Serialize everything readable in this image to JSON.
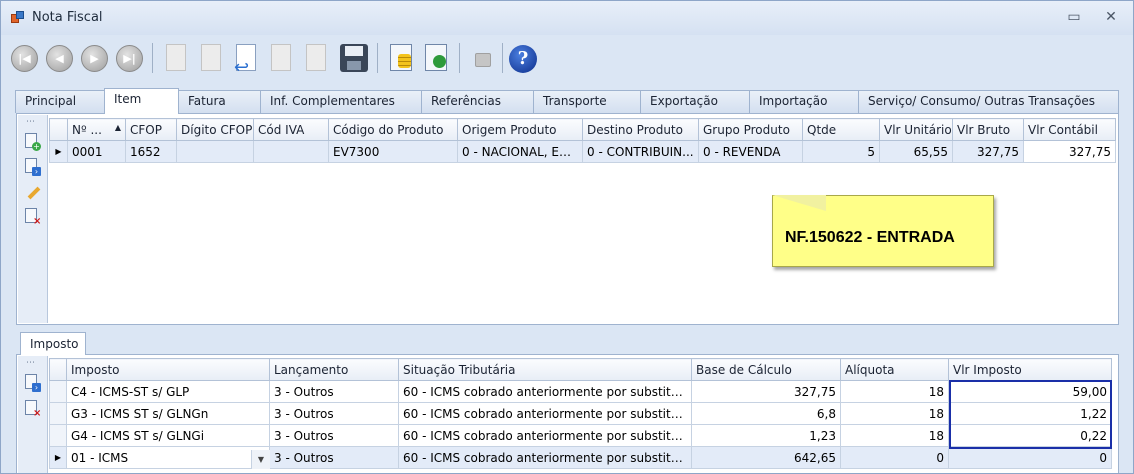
{
  "window": {
    "title": "Nota Fiscal",
    "minimize": "▭",
    "close": "✕"
  },
  "toolbar": {
    "help": "?"
  },
  "tabs": [
    "Principal",
    "Item",
    "Fatura",
    "Inf. Complementares",
    "Referências",
    "Transporte",
    "Exportação",
    "Importação",
    "Serviço/ Consumo/ Outras Transações"
  ],
  "items_table": {
    "columns": [
      "Nº ...",
      "CFOP",
      "Dígito CFOP",
      "Cód IVA",
      "Código do Produto",
      "Origem Produto",
      "Destino Produto",
      "Grupo Produto",
      "Qtde",
      "Vlr Unitário",
      "Vlr Bruto",
      "Vlr Contábil"
    ],
    "sort_indicator": "▲",
    "rows": [
      [
        "0001",
        "1652",
        "",
        "",
        "EV7300",
        "0 - NACIONAL, EX...",
        "0 - CONTRIBUIN...",
        "0 - REVENDA",
        "5",
        "65,55",
        "327,75",
        "327,75"
      ]
    ]
  },
  "note": {
    "text": "NF.150622 - ENTRADA",
    "color": "#ffff88"
  },
  "subtabs": [
    "Imposto"
  ],
  "tax_table": {
    "columns": [
      "Imposto",
      "Lançamento",
      "Situação Tributária",
      "Base de Cálculo",
      "Alíquota",
      "Vlr Imposto"
    ],
    "rows": [
      [
        "C4 - ICMS-ST s/ GLP",
        "3 - Outros",
        "60 - ICMS cobrado anteriormente por substituiçã...",
        "327,75",
        "18",
        "59,00"
      ],
      [
        "G3 - ICMS ST s/ GLNGn",
        "3 - Outros",
        "60 - ICMS cobrado anteriormente por substituiçã...",
        "6,8",
        "18",
        "1,22"
      ],
      [
        "G4 - ICMS ST s/ GLNGi",
        "3 - Outros",
        "60 - ICMS cobrado anteriormente por substituiçã...",
        "1,23",
        "18",
        "0,22"
      ],
      [
        "01 - ICMS",
        "3 - Outros",
        "60 - ICMS cobrado anteriormente por substituiçã...",
        "642,65",
        "0",
        "0"
      ]
    ]
  },
  "colors": {
    "highlight_border": "#1a2fa8",
    "help_blue": "#0c2d8a"
  },
  "icons": [
    "first-record-icon",
    "prev-record-icon",
    "next-record-icon",
    "last-record-icon",
    "new-icon",
    "edit-icon",
    "undo-icon",
    "cancel-icon",
    "redo-icon",
    "save-icon",
    "calc-tax-icon",
    "refresh-doc-icon",
    "lock-icon",
    "help-icon"
  ]
}
